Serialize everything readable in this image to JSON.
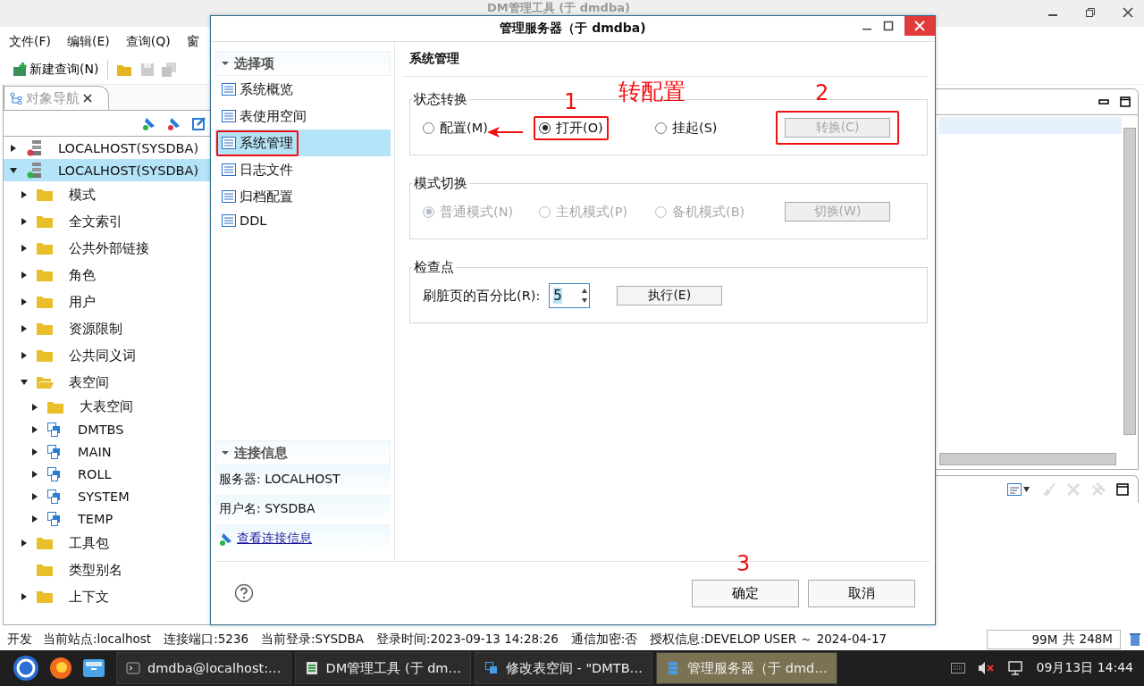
{
  "main_window": {
    "title": "DM管理工具 (于 dmdba)"
  },
  "menu": [
    "文件(F)",
    "编辑(E)",
    "查询(Q)",
    "窗"
  ],
  "toolbar": {
    "new_query": "新建查询(N)"
  },
  "navigator": {
    "tab": "对象导航",
    "tree": [
      {
        "label": "LOCALHOST(SYSDBA)",
        "kind": "server",
        "connected": false,
        "expandable": true,
        "expanded": false,
        "selected": false
      },
      {
        "label": "LOCALHOST(SYSDBA)",
        "kind": "server",
        "connected": true,
        "expandable": true,
        "expanded": true,
        "selected": true,
        "children": [
          {
            "label": "模式",
            "kind": "folder",
            "expandable": true,
            "expanded": false,
            "selected": false
          },
          {
            "label": "全文索引",
            "kind": "folder",
            "expandable": true,
            "expanded": false,
            "selected": false
          },
          {
            "label": "公共外部链接",
            "kind": "folder",
            "expandable": true,
            "expanded": false,
            "selected": false
          },
          {
            "label": "角色",
            "kind": "folder",
            "expandable": true,
            "expanded": false,
            "selected": false
          },
          {
            "label": "用户",
            "kind": "folder",
            "expandable": true,
            "expanded": false,
            "selected": false
          },
          {
            "label": "资源限制",
            "kind": "folder",
            "expandable": true,
            "expanded": false,
            "selected": false
          },
          {
            "label": "公共同义词",
            "kind": "folder",
            "expandable": true,
            "expanded": false,
            "selected": false
          },
          {
            "label": "表空间",
            "kind": "folder",
            "expandable": true,
            "expanded": true,
            "selected": false,
            "children": [
              {
                "label": "大表空间",
                "kind": "folder",
                "expandable": true,
                "expanded": false,
                "selected": false
              },
              {
                "label": "DMTBS",
                "kind": "tablespace",
                "expandable": true,
                "expanded": false,
                "selected": false
              },
              {
                "label": "MAIN",
                "kind": "tablespace",
                "expandable": true,
                "expanded": false,
                "selected": false
              },
              {
                "label": "ROLL",
                "kind": "tablespace",
                "expandable": true,
                "expanded": false,
                "selected": false
              },
              {
                "label": "SYSTEM",
                "kind": "tablespace",
                "expandable": true,
                "expanded": false,
                "selected": false
              },
              {
                "label": "TEMP",
                "kind": "tablespace",
                "expandable": true,
                "expanded": false,
                "selected": false
              }
            ]
          },
          {
            "label": "工具包",
            "kind": "folder",
            "expandable": true,
            "expanded": false,
            "selected": false
          },
          {
            "label": "类型别名",
            "kind": "folder",
            "expandable": false,
            "expanded": false,
            "selected": false
          },
          {
            "label": "上下文",
            "kind": "folder",
            "expandable": true,
            "expanded": false,
            "selected": false
          }
        ]
      }
    ]
  },
  "dialog": {
    "title": "管理服务器（于 dmdba)",
    "nav_header": "选择项",
    "nav_items": [
      {
        "label": "系统概览",
        "selected": false,
        "highlighted": false
      },
      {
        "label": "表使用空间",
        "selected": false,
        "highlighted": false
      },
      {
        "label": "系统管理",
        "selected": true,
        "highlighted": true
      },
      {
        "label": "日志文件",
        "selected": false,
        "highlighted": false
      },
      {
        "label": "归档配置",
        "selected": false,
        "highlighted": false
      },
      {
        "label": "DDL",
        "selected": false,
        "highlighted": false
      }
    ],
    "conn_header": "连接信息",
    "conn_rows": [
      "服务器: LOCALHOST",
      "用户名: SYSDBA"
    ],
    "conn_link": "查看连接信息",
    "page_title": "系统管理",
    "groups": [
      {
        "kind": "radios",
        "title": "状态转换",
        "disabled": false,
        "options": [
          {
            "label": "配置(M)",
            "selected": false,
            "highlighted": false
          },
          {
            "label": "打开(O)",
            "selected": true,
            "highlighted": true,
            "note": "1",
            "caption": "转配置",
            "arrow": true
          },
          {
            "label": "挂起(S)",
            "selected": false,
            "highlighted": false
          }
        ],
        "button": {
          "label": "转换(C)",
          "disabled": true,
          "highlighted": true,
          "note": "2"
        }
      },
      {
        "kind": "radios",
        "title": "模式切换",
        "disabled": true,
        "options": [
          {
            "label": "普通模式(N)",
            "selected": true,
            "highlighted": false
          },
          {
            "label": "主机模式(P)",
            "selected": false,
            "highlighted": false
          },
          {
            "label": "备机模式(B)",
            "selected": false,
            "highlighted": false
          }
        ],
        "button": {
          "label": "切换(W)",
          "disabled": true,
          "highlighted": false
        }
      },
      {
        "kind": "spinner",
        "title": "检查点",
        "label": "刷脏页的百分比(R):",
        "value": "5",
        "button": {
          "label": "执行(E)",
          "disabled": false,
          "highlighted": false
        }
      }
    ],
    "buttons": [
      {
        "label": "确定",
        "note": "3"
      },
      {
        "label": "取消"
      }
    ]
  },
  "status_bar": [
    "开发",
    "当前站点:localhost",
    "连接端口:5236",
    "当前登录:SYSDBA",
    "登录时间:2023-09-13 14:28:26",
    "通信加密:否",
    "授权信息:DEVELOP USER ～ 2024-04-17"
  ],
  "memory": {
    "used": "99M",
    "total": "共 248M"
  },
  "taskbar": {
    "tasks": [
      {
        "label": "dmdba@localhost:…",
        "kind": "terminal",
        "selected": false
      },
      {
        "label": "DM管理工具 (于 dm…",
        "kind": "app",
        "selected": false
      },
      {
        "label": "修改表空间 - \"DMTB…",
        "kind": "tablespace",
        "selected": false
      },
      {
        "label": "管理服务器（于 dmd…",
        "kind": "server",
        "selected": true
      }
    ],
    "clock": "09月13日 14:44"
  }
}
